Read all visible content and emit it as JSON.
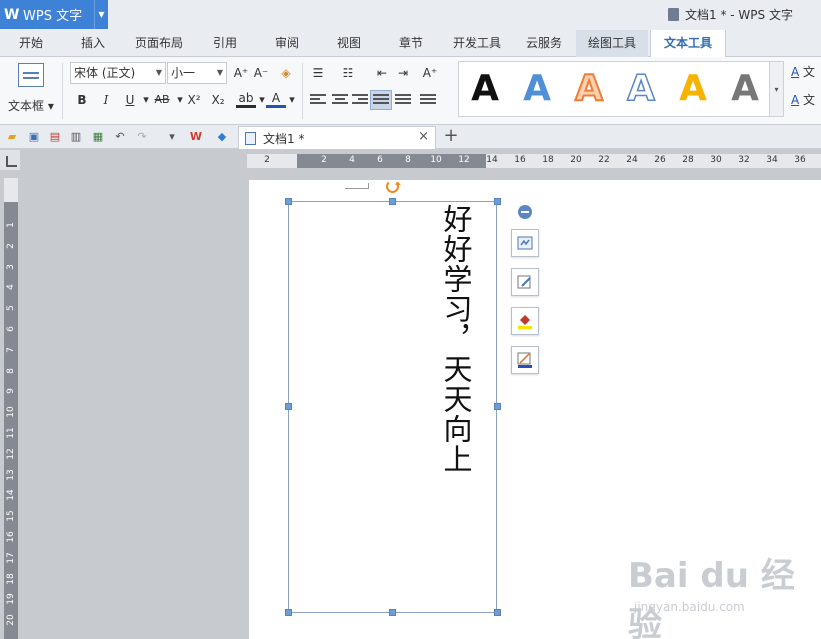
{
  "titlebar": {
    "app_name": "WPS 文字",
    "window_title": "文档1 * - WPS 文字",
    "app_color": "#3d82d6"
  },
  "menu": {
    "tabs": [
      "开始",
      "插入",
      "页面布局",
      "引用",
      "审阅",
      "视图",
      "章节",
      "开发工具",
      "云服务",
      "绘图工具",
      "文本工具"
    ],
    "active": "文本工具"
  },
  "ribbon": {
    "textbox_label": "文本框",
    "font_name": "宋体 (正文)",
    "font_size": "小一",
    "styles": [
      {
        "letter": "A",
        "name": "black-solid"
      },
      {
        "letter": "A",
        "name": "blue-gradient"
      },
      {
        "letter": "A",
        "name": "orange-outline"
      },
      {
        "letter": "A",
        "name": "blue-outline"
      },
      {
        "letter": "A",
        "name": "gold-solid"
      },
      {
        "letter": "A",
        "name": "gray-gradient"
      }
    ],
    "right_labels": [
      "文",
      "文"
    ]
  },
  "quickbar": {
    "doc_tab_label": "文档1 *",
    "close_glyph": "×",
    "new_tab_glyph": "+"
  },
  "ruler": {
    "horizontal": [
      "2",
      "2",
      "4",
      "6",
      "8",
      "10",
      "12",
      "14",
      "16",
      "18",
      "20",
      "22",
      "24",
      "26",
      "28",
      "30",
      "32",
      "34",
      "36"
    ],
    "vertical": [
      "1",
      "2",
      "3",
      "4",
      "5",
      "6",
      "7",
      "8",
      "9",
      "10",
      "11",
      "12",
      "13",
      "14",
      "15",
      "16",
      "17",
      "18",
      "19",
      "20"
    ]
  },
  "document": {
    "vertical_text": "好好学习，天天向上"
  },
  "watermark": {
    "brand": "Bai du 经验",
    "url": "jingyan.baidu.com"
  }
}
